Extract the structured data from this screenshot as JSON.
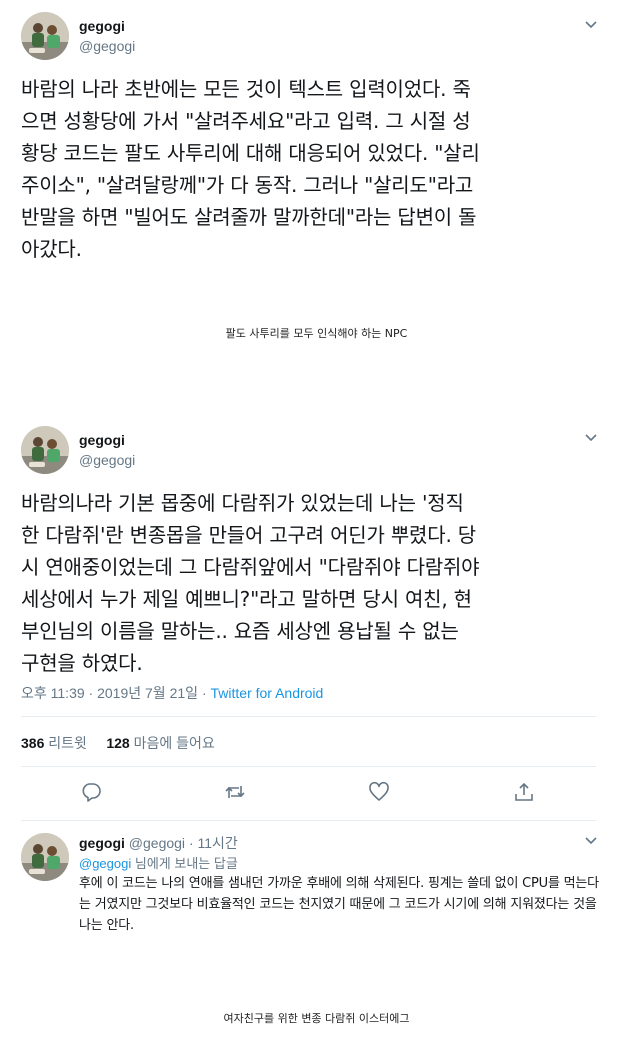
{
  "tweet1": {
    "name": "gegogi",
    "handle": "@gegogi",
    "text": "바람의 나라 초반에는 모든 것이 텍스트 입력이었다. 죽\n으면 성황당에 가서 \"살려주세요\"라고 입력. 그 시절 성\n황당 코드는 팔도 사투리에 대해 대응되어 있었다. \"살리\n주이소\", \"살려달랑께\"가 다 동작. 그러나 \"살리도\"라고\n반말을 하면 \"빌어도 살려줄까 말까한데\"라는 답변이 돌\n아갔다."
  },
  "caption1": "팔도 사투리를 모두 인식해야 하는 NPC",
  "tweet2": {
    "name": "gegogi",
    "handle": "@gegogi",
    "text": "바람의나라 기본 몹중에 다람쥐가 있었는데 나는 '정직\n한 다람쥐'란 변종몹을 만들어 고구려 어딘가 뿌렸다. 당\n시 연애중이었는데 그 다람쥐앞에서 \"다람쥐야 다람쥐야\n세상에서 누가 제일 예쁘니?\"라고 말하면 당시 여친, 현\n부인님의 이름을 말하는.. 요즘 세상엔 용납될 수 없는\n구현을 하였다.",
    "time": "오후 11:39",
    "separator": "·",
    "date": "2019년 7월 21일",
    "source": "Twitter for Android",
    "retweet_count": "386",
    "retweet_label": "리트윗",
    "like_count": "128",
    "like_label": "마음에 들어요"
  },
  "reply": {
    "name": "gegogi",
    "handle": "@gegogi",
    "separator": "·",
    "time": "11시간",
    "reply_to_user": "@gegogi",
    "reply_to_suffix": "님에게 보내는 답글",
    "text": "후에 이 코드는 나의 연애를 샘내던 가까운 후배에 의해 삭제된다. 핑계는 쓸데 없이 CPU를 먹는다는 거였지만 그것보다 비효율적인 코드는 천지였기 때문에 그 코드가 시기에 의해 지워졌다는 것을 나는 안다."
  },
  "caption2": "여자친구를 위한 변종 다람쥐 이스터에그",
  "icons": {
    "menu": "chevron-down-icon",
    "reply": "reply-icon",
    "retweet": "retweet-icon",
    "like": "heart-icon",
    "share": "share-icon"
  },
  "colors": {
    "text": "#14171a",
    "muted": "#657786",
    "link": "#1b95e0",
    "divider": "#e6ecf0"
  }
}
